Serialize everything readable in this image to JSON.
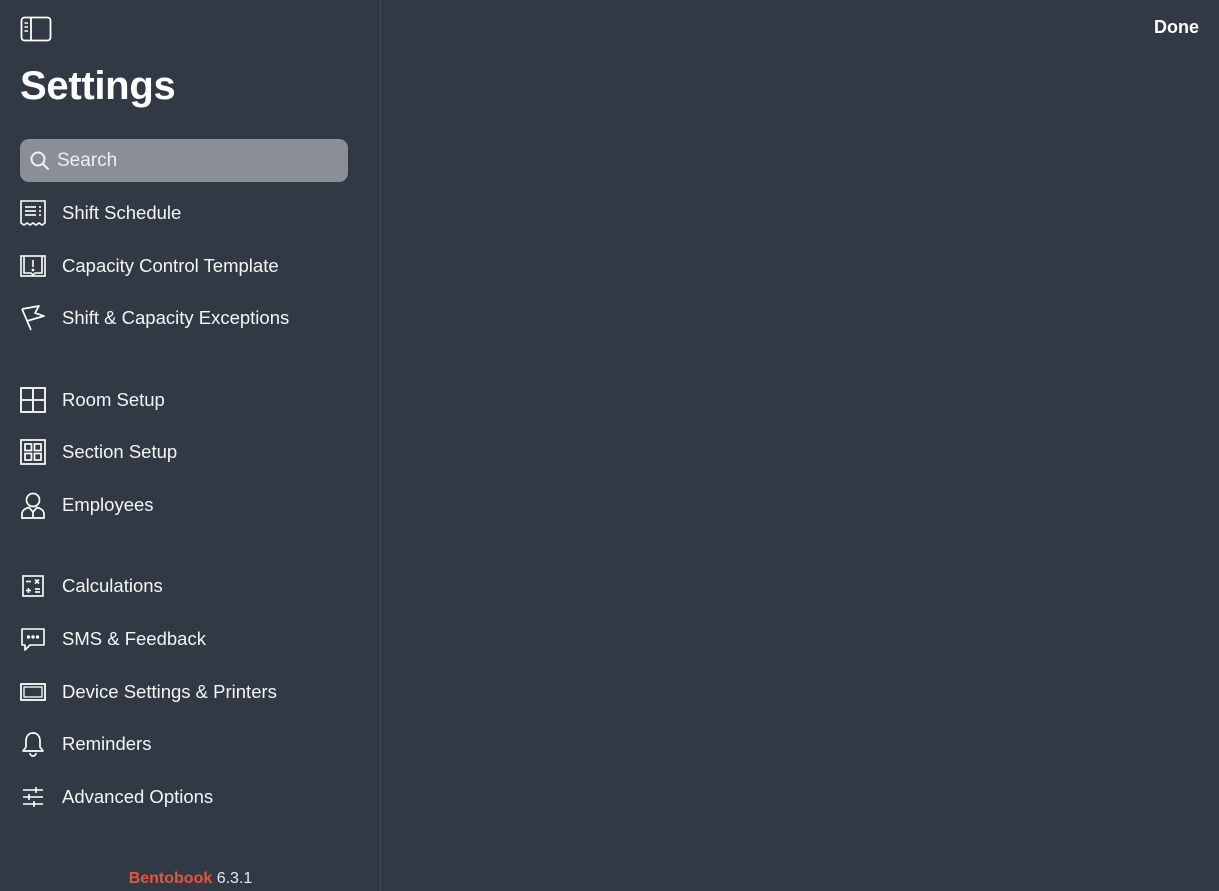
{
  "sidebar": {
    "title": "Settings",
    "search": {
      "placeholder": "Search",
      "value": ""
    },
    "items": [
      {
        "label": "Shift Schedule",
        "icon": "receipt-icon"
      },
      {
        "label": "Capacity Control Template",
        "icon": "book-info-icon"
      },
      {
        "label": "Shift & Capacity Exceptions",
        "icon": "flag-icon"
      },
      {
        "label": "Room Setup",
        "icon": "grid-icon"
      },
      {
        "label": "Section Setup",
        "icon": "sections-icon"
      },
      {
        "label": "Employees",
        "icon": "person-icon"
      },
      {
        "label": "Calculations",
        "icon": "calculator-icon"
      },
      {
        "label": "SMS & Feedback",
        "icon": "chat-icon"
      },
      {
        "label": "Device Settings & Printers",
        "icon": "device-icon"
      },
      {
        "label": "Reminders",
        "icon": "bell-icon"
      },
      {
        "label": "Advanced Options",
        "icon": "sliders-icon"
      }
    ],
    "footer": {
      "brand": "Bentobook",
      "version": "6.3.1"
    }
  },
  "header": {
    "done_label": "Done"
  },
  "colors": {
    "background": "#313a44",
    "search_fill": "#8a8e97",
    "brand": "#e2563e"
  }
}
